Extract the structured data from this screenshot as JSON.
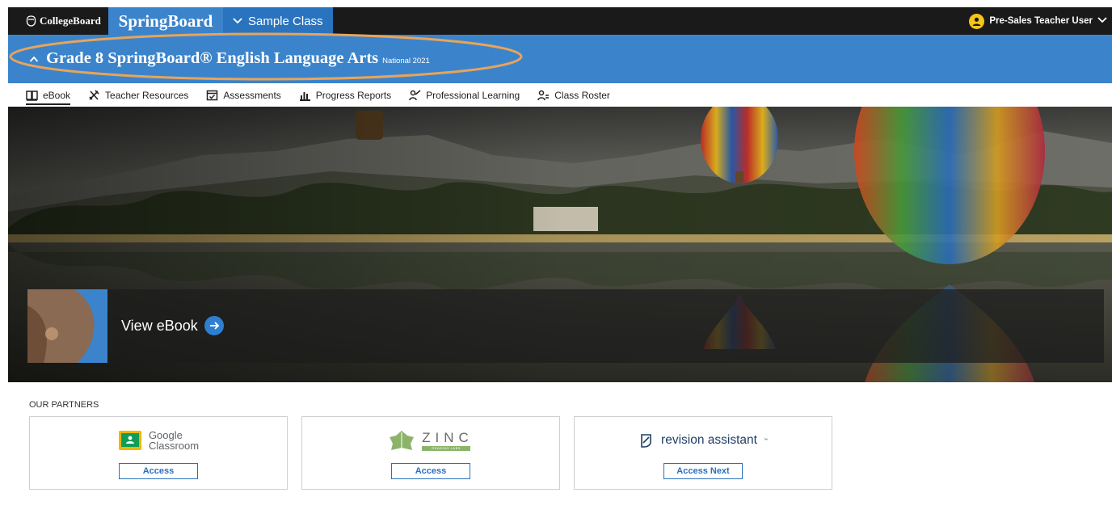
{
  "topbar": {
    "collegeboard_logo": "CollegeBoard",
    "springboard_brand": "SpringBoard",
    "class_selector": "Sample Class",
    "user_name": "Pre-Sales Teacher User"
  },
  "course": {
    "title": "Grade 8 SpringBoard® English Language Arts",
    "edition": "National 2021"
  },
  "nav": {
    "items": [
      {
        "label": "eBook",
        "icon": "book-icon",
        "active": true
      },
      {
        "label": "Teacher Resources",
        "icon": "tools-icon"
      },
      {
        "label": "Assessments",
        "icon": "checklist-icon"
      },
      {
        "label": "Progress Reports",
        "icon": "bar-chart-icon"
      },
      {
        "label": "Professional Learning",
        "icon": "teacher-icon"
      },
      {
        "label": "Class Roster",
        "icon": "roster-icon"
      }
    ]
  },
  "hero": {
    "view_ebook_label": "View eBook"
  },
  "partners": {
    "heading": "OUR PARTNERS",
    "cards": [
      {
        "name_line1": "Google",
        "name_line2": "Classroom",
        "button": "Access"
      },
      {
        "name": "ZINC",
        "sub": "READING LABS",
        "button": "Access"
      },
      {
        "name": "revision assistant",
        "tm": "™",
        "button": "Access Next"
      }
    ]
  },
  "colors": {
    "brand_blue": "#3b84cc",
    "dark_bar": "#1a1a1a",
    "highlight_orange": "#e8a45a",
    "link_blue": "#2a6fbf"
  }
}
